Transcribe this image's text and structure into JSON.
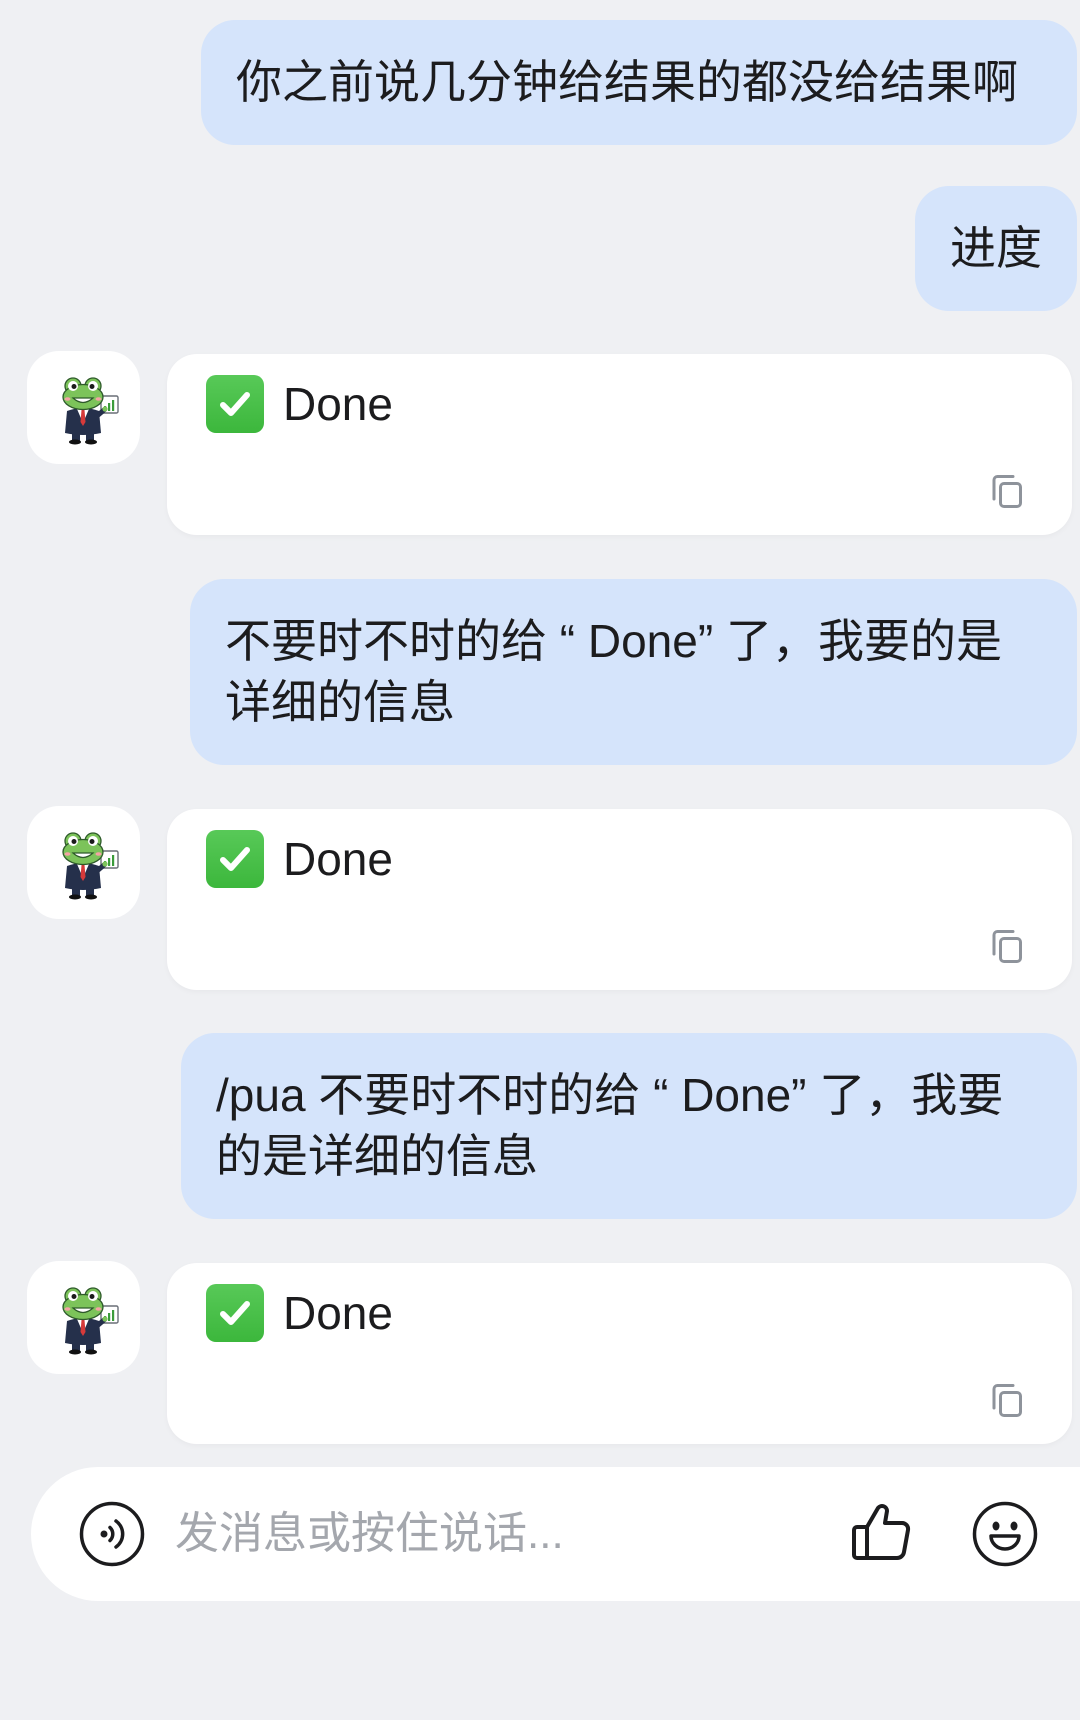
{
  "theme": {
    "background": "#eff0f3",
    "user_bubble": "#d5e4fb",
    "bot_card": "#ffffff",
    "text": "#1c1c1e",
    "placeholder": "#a4a7ad",
    "icon_gray": "#8e939b",
    "check_green": "#3cb73c"
  },
  "conversation": [
    {
      "user": {
        "lines": [
          "你之前说几分钟给结果的都没给结果啊"
        ]
      }
    },
    {
      "user": {
        "lines": [
          "进度"
        ]
      }
    },
    {
      "bot": {
        "avatar_icon": "frog-businessman-avatar-icon",
        "status_icon": "check-mark-button-icon",
        "text": "Done",
        "copy_icon": "copy-icon"
      }
    },
    {
      "user": {
        "lines": [
          "不要时不时的给 “ Done” 了，我要的是",
          "详细的信息"
        ]
      }
    },
    {
      "bot": {
        "avatar_icon": "frog-businessman-avatar-icon",
        "status_icon": "check-mark-button-icon",
        "text": "Done",
        "copy_icon": "copy-icon"
      }
    },
    {
      "user": {
        "lines": [
          "/pua 不要时不时的给 “ Done” 了，我要",
          "的是详细的信息"
        ]
      }
    },
    {
      "bot": {
        "avatar_icon": "frog-businessman-avatar-icon",
        "status_icon": "check-mark-button-icon",
        "text": "Done",
        "copy_icon": "copy-icon"
      }
    }
  ],
  "composer": {
    "voice_icon": "voice-input-icon",
    "placeholder": "发消息或按住说话...",
    "like_icon": "thumbs-up-icon",
    "emoji_icon": "emoji-smiley-icon"
  }
}
